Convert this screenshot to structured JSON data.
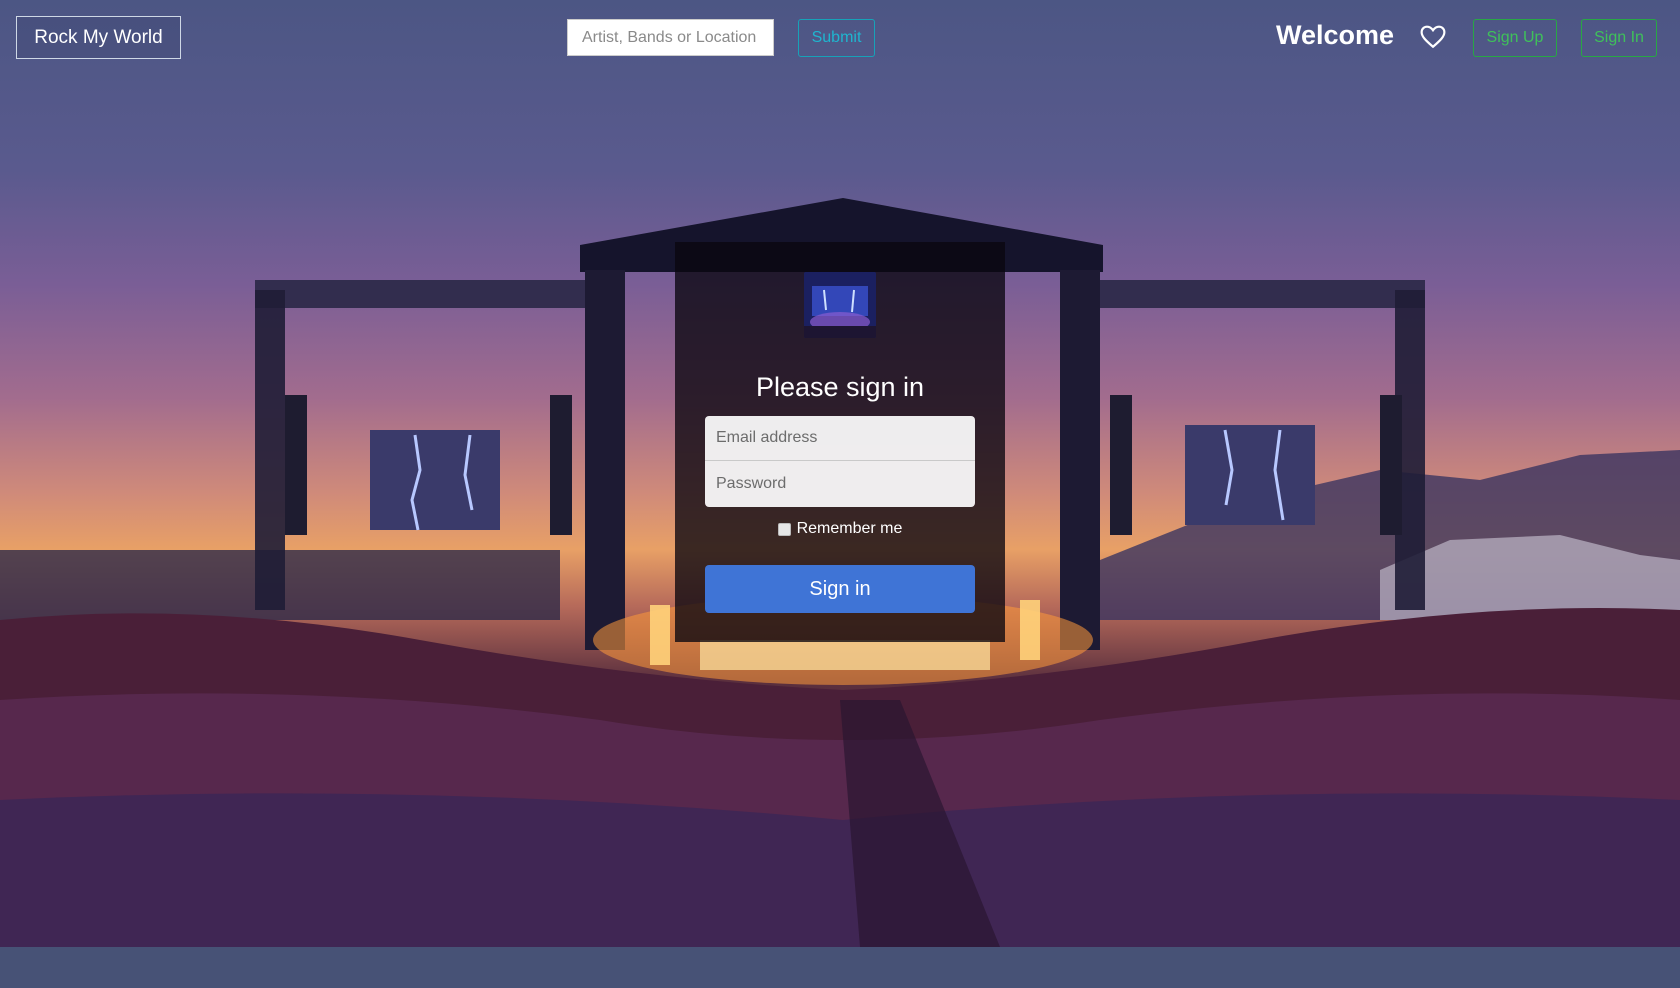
{
  "nav": {
    "brand": "Rock My World",
    "search_placeholder": "Artist, Bands or Location",
    "submit_label": "Submit",
    "welcome_text": "Welcome",
    "favorites_icon": "heart-outline-icon",
    "signup_label": "Sign Up",
    "signin_label": "Sign In"
  },
  "signin_panel": {
    "title": "Please sign in",
    "email_placeholder": "Email address",
    "password_placeholder": "Password",
    "remember_label": "Remember me",
    "submit_label": "Sign in"
  },
  "colors": {
    "info": "#17a2b8",
    "success": "#28a745",
    "primary": "#3f74d6",
    "footer": "#475276"
  }
}
